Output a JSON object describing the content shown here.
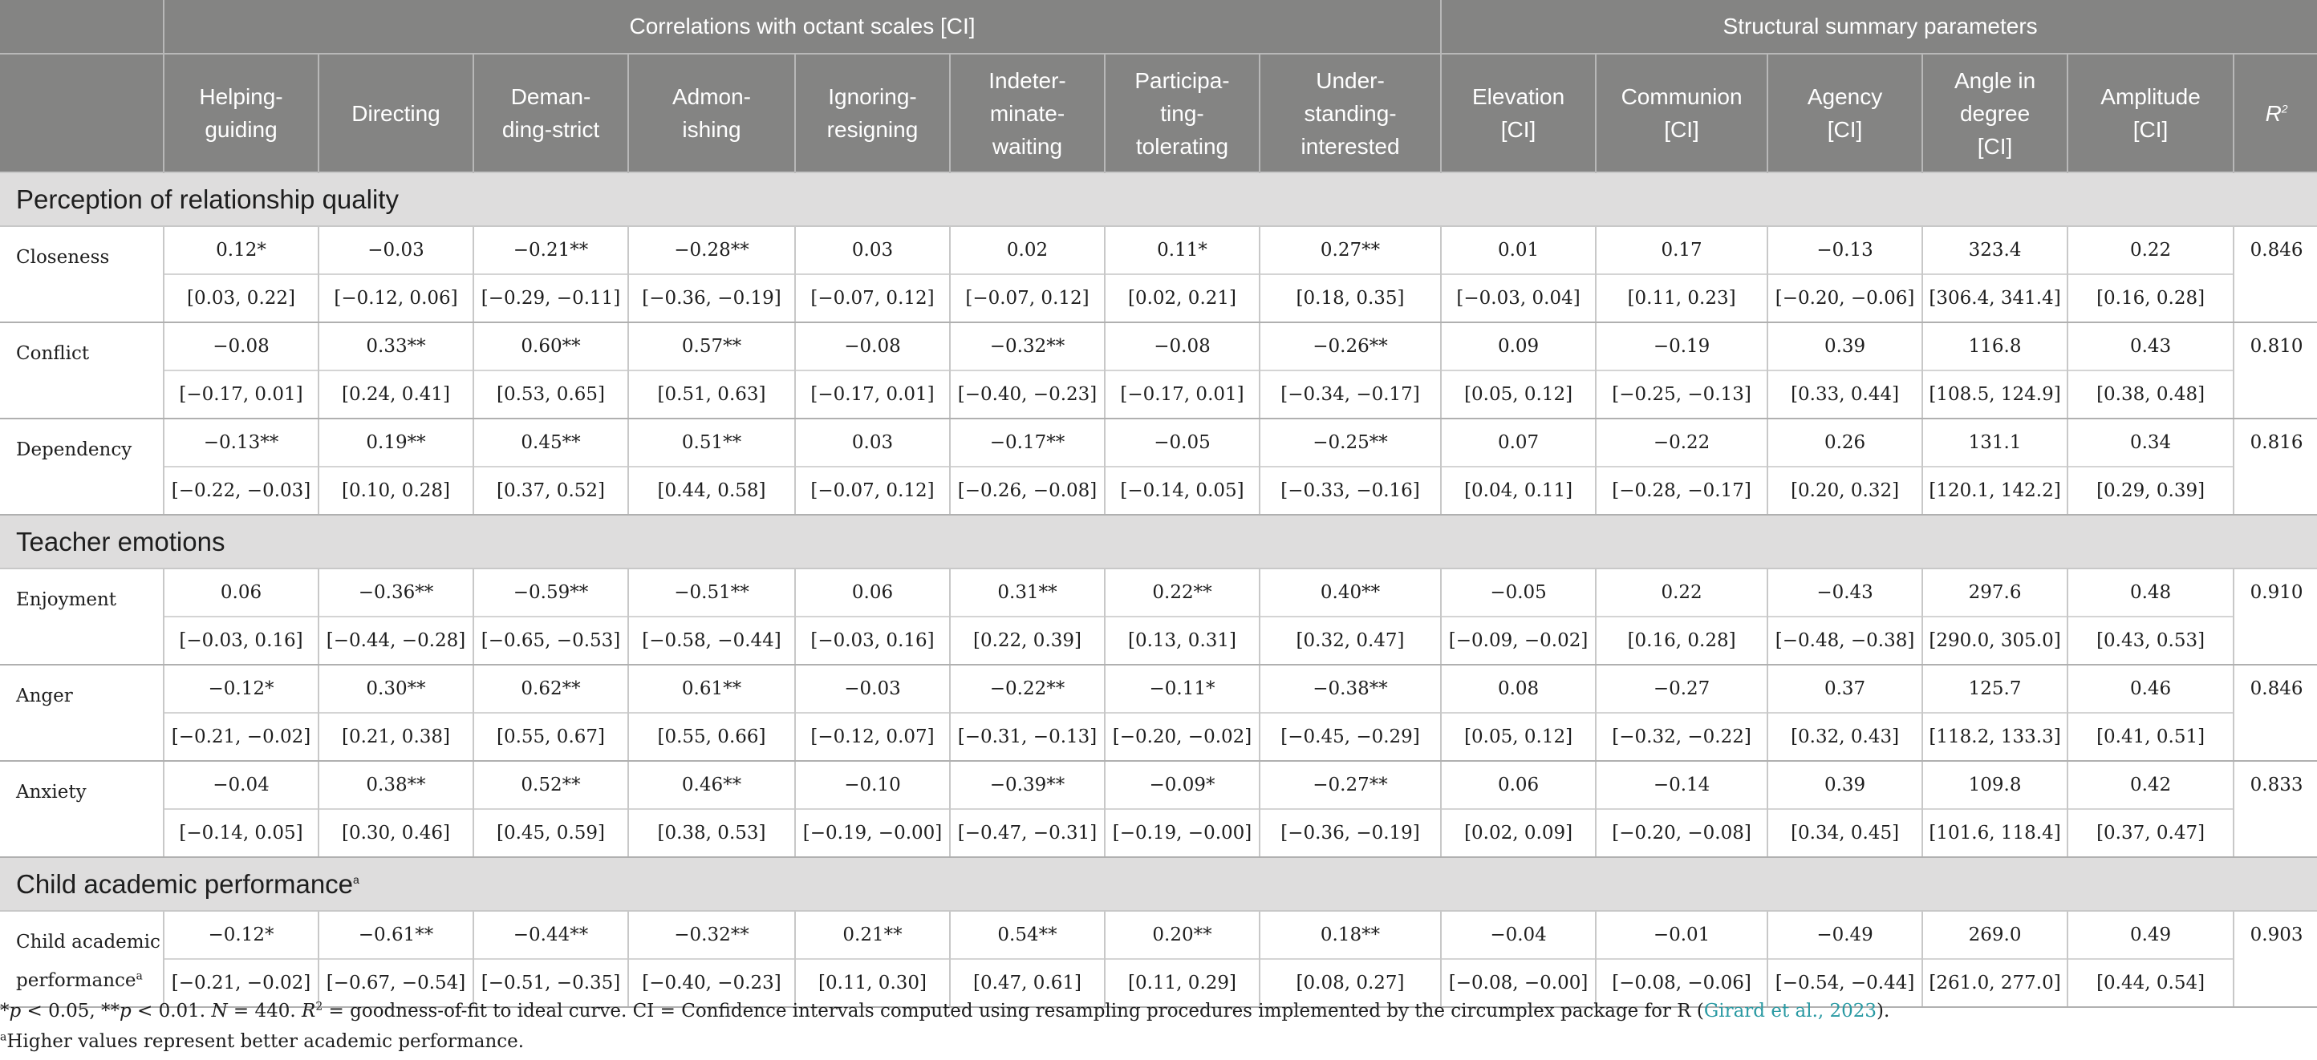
{
  "header": {
    "group_correlations": "Correlations with octant scales [CI]",
    "group_structural": "Structural summary parameters",
    "columns": [
      [
        "Helping-",
        "guiding"
      ],
      [
        "Directing"
      ],
      [
        "Deman-",
        "ding-strict"
      ],
      [
        "Admon-",
        "ishing"
      ],
      [
        "Ignoring-",
        "resigning"
      ],
      [
        "Indeter-",
        "minate-",
        "waiting"
      ],
      [
        "Participa-",
        "ting-",
        "tolerating"
      ],
      [
        "Under-",
        "standing-",
        "interested"
      ],
      [
        "Elevation",
        "[CI]"
      ],
      [
        "Communion",
        "[CI]"
      ],
      [
        "Agency",
        "[CI]"
      ],
      [
        "Angle in",
        "degree",
        "[CI]"
      ],
      [
        "Amplitude",
        "[CI]"
      ]
    ],
    "r2_label": "R"
  },
  "sections": [
    {
      "title": "Perception of relationship quality",
      "title_sup": "",
      "rows": [
        {
          "label": "Closeness",
          "label_sup": "",
          "values": [
            "0.12*",
            "−0.03",
            "−0.21**",
            "−0.28**",
            "0.03",
            "0.02",
            "0.11*",
            "0.27**",
            "0.01",
            "0.17",
            "−0.13",
            "323.4",
            "0.22"
          ],
          "cis": [
            "[0.03, 0.22]",
            "[−0.12, 0.06]",
            "[−0.29, −0.11]",
            "[−0.36, −0.19]",
            "[−0.07, 0.12]",
            "[−0.07, 0.12]",
            "[0.02, 0.21]",
            "[0.18, 0.35]",
            "[−0.03, 0.04]",
            "[0.11, 0.23]",
            "[−0.20, −0.06]",
            "[306.4, 341.4]",
            "[0.16, 0.28]"
          ],
          "r2": "0.846"
        },
        {
          "label": "Conflict",
          "label_sup": "",
          "values": [
            "−0.08",
            "0.33**",
            "0.60**",
            "0.57**",
            "−0.08",
            "−0.32**",
            "−0.08",
            "−0.26**",
            "0.09",
            "−0.19",
            "0.39",
            "116.8",
            "0.43"
          ],
          "cis": [
            "[−0.17, 0.01]",
            "[0.24, 0.41]",
            "[0.53, 0.65]",
            "[0.51, 0.63]",
            "[−0.17, 0.01]",
            "[−0.40, −0.23]",
            "[−0.17, 0.01]",
            "[−0.34, −0.17]",
            "[0.05, 0.12]",
            "[−0.25, −0.13]",
            "[0.33, 0.44]",
            "[108.5, 124.9]",
            "[0.38, 0.48]"
          ],
          "r2": "0.810"
        },
        {
          "label": "Dependency",
          "label_sup": "",
          "values": [
            "−0.13**",
            "0.19**",
            "0.45**",
            "0.51**",
            "0.03",
            "−0.17**",
            "−0.05",
            "−0.25**",
            "0.07",
            "−0.22",
            "0.26",
            "131.1",
            "0.34"
          ],
          "cis": [
            "[−0.22, −0.03]",
            "[0.10, 0.28]",
            "[0.37, 0.52]",
            "[0.44, 0.58]",
            "[−0.07, 0.12]",
            "[−0.26, −0.08]",
            "[−0.14, 0.05]",
            "[−0.33, −0.16]",
            "[0.04, 0.11]",
            "[−0.28, −0.17]",
            "[0.20, 0.32]",
            "[120.1, 142.2]",
            "[0.29, 0.39]"
          ],
          "r2": "0.816"
        }
      ]
    },
    {
      "title": "Teacher emotions",
      "title_sup": "",
      "rows": [
        {
          "label": "Enjoyment",
          "label_sup": "",
          "values": [
            "0.06",
            "−0.36**",
            "−0.59**",
            "−0.51**",
            "0.06",
            "0.31**",
            "0.22**",
            "0.40**",
            "−0.05",
            "0.22",
            "−0.43",
            "297.6",
            "0.48"
          ],
          "cis": [
            "[−0.03, 0.16]",
            "[−0.44, −0.28]",
            "[−0.65, −0.53]",
            "[−0.58, −0.44]",
            "[−0.03, 0.16]",
            "[0.22, 0.39]",
            "[0.13, 0.31]",
            "[0.32, 0.47]",
            "[−0.09, −0.02]",
            "[0.16, 0.28]",
            "[−0.48, −0.38]",
            "[290.0, 305.0]",
            "[0.43, 0.53]"
          ],
          "r2": "0.910"
        },
        {
          "label": "Anger",
          "label_sup": "",
          "values": [
            "−0.12*",
            "0.30**",
            "0.62**",
            "0.61**",
            "−0.03",
            "−0.22**",
            "−0.11*",
            "−0.38**",
            "0.08",
            "−0.27",
            "0.37",
            "125.7",
            "0.46"
          ],
          "cis": [
            "[−0.21, −0.02]",
            "[0.21, 0.38]",
            "[0.55, 0.67]",
            "[0.55, 0.66]",
            "[−0.12, 0.07]",
            "[−0.31, −0.13]",
            "[−0.20, −0.02]",
            "[−0.45, −0.29]",
            "[0.05, 0.12]",
            "[−0.32, −0.22]",
            "[0.32, 0.43]",
            "[118.2, 133.3]",
            "[0.41, 0.51]"
          ],
          "r2": "0.846"
        },
        {
          "label": "Anxiety",
          "label_sup": "",
          "values": [
            "−0.04",
            "0.38**",
            "0.52**",
            "0.46**",
            "−0.10",
            "−0.39**",
            "−0.09*",
            "−0.27**",
            "0.06",
            "−0.14",
            "0.39",
            "109.8",
            "0.42"
          ],
          "cis": [
            "[−0.14, 0.05]",
            "[0.30, 0.46]",
            "[0.45, 0.59]",
            "[0.38, 0.53]",
            "[−0.19, −0.00]",
            "[−0.47, −0.31]",
            "[−0.19, −0.00]",
            "[−0.36, −0.19]",
            "[0.02, 0.09]",
            "[−0.20, −0.08]",
            "[0.34, 0.45]",
            "[101.6, 118.4]",
            "[0.37, 0.47]"
          ],
          "r2": "0.833"
        }
      ]
    },
    {
      "title": "Child academic performance",
      "title_sup": "a",
      "rows": [
        {
          "label": "Child academic performance",
          "label_sup": "a",
          "values": [
            "−0.12*",
            "−0.61**",
            "−0.44**",
            "−0.32**",
            "0.21**",
            "0.54**",
            "0.20**",
            "0.18**",
            "−0.04",
            "−0.01",
            "−0.49",
            "269.0",
            "0.49"
          ],
          "cis": [
            "[−0.21, −0.02]",
            "[−0.67, −0.54]",
            "[−0.51, −0.35]",
            "[−0.40, −0.23]",
            "[0.11, 0.30]",
            "[0.47, 0.61]",
            "[0.11, 0.29]",
            "[0.08, 0.27]",
            "[−0.08, −0.00]",
            "[−0.08, −0.06]",
            "[−0.54, −0.44]",
            "[261.0, 277.0]",
            "[0.44, 0.54]"
          ],
          "r2": "0.903"
        }
      ]
    }
  ],
  "notes": {
    "line1_a": "*p < 0.05, **p < 0.01. N = 440. R² = goodness-of-fit to ideal curve. CI = Confidence intervals computed using resampling procedures implemented by the circumplex package for R (",
    "line1_cite": "Girard et al., 2023",
    "line1_b": ").",
    "line2": "Higher values represent better academic performance.",
    "line2_sup": "a"
  }
}
